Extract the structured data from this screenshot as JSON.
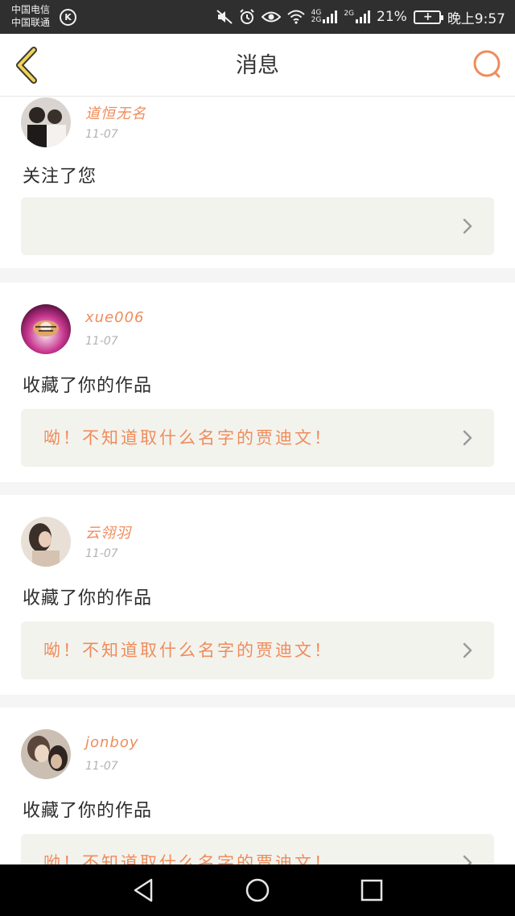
{
  "status_bar": {
    "carrier_1": "中国电信",
    "carrier_2": "中国联通",
    "carrier_badge": "K",
    "net_1_top": "4G",
    "net_1_bottom": "2G",
    "net_2": "2G",
    "battery_percent": "21%",
    "battery_symbol": "+",
    "time": "晚上9:57",
    "icons": [
      "mute-icon",
      "alarm-icon",
      "eye-icon",
      "wifi-icon",
      "signal-icon",
      "battery-icon"
    ]
  },
  "header": {
    "title": "消息",
    "back_icon": "back-arrow-icon",
    "search_icon": "search-icon",
    "accent_color": "#ef8c5b"
  },
  "notifications": [
    {
      "username": "道恒无名",
      "date": "11-07",
      "action": "关注了您",
      "work_title": ""
    },
    {
      "username": "xue006",
      "date": "11-07",
      "action": "收藏了你的作品",
      "work_title": "呦！不知道取什么名字的贾迪文！"
    },
    {
      "username": "云翎羽",
      "date": "11-07",
      "action": "收藏了你的作品",
      "work_title": "呦！不知道取什么名字的贾迪文！"
    },
    {
      "username": "jonboy",
      "date": "11-07",
      "action": "收藏了你的作品",
      "work_title": "呦！不知道取什么名字的贾迪文！"
    }
  ],
  "nav_bar": {
    "icons": [
      "back-triangle-icon",
      "home-circle-icon",
      "recents-square-icon"
    ]
  }
}
